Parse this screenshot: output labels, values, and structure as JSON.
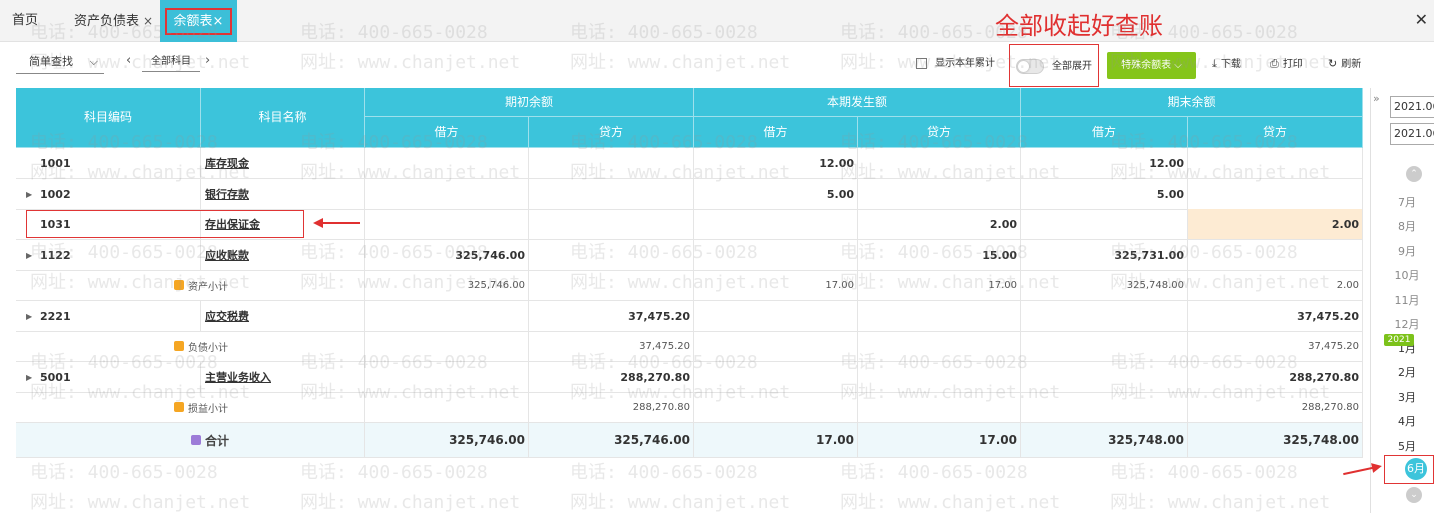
{
  "tabs": {
    "home": "首页",
    "balance_sheet": "资产负债表",
    "trial_balance": "余额表",
    "close": "×"
  },
  "annotation_title": "全部收起好查账",
  "toolbar": {
    "search_mode": "简单查找",
    "all_subjects": "全部科目",
    "show_year_cumulative": "显示本年累计",
    "expand_all": "全部展开",
    "special_balance": "特殊余额表",
    "download": "下载",
    "print": "打印",
    "refresh": "刷新"
  },
  "table": {
    "headers": {
      "code": "科目编码",
      "name": "科目名称",
      "opening": "期初余额",
      "current": "本期发生额",
      "closing": "期末余额",
      "debit": "借方",
      "credit": "贷方"
    },
    "rows": [
      {
        "code": "1001",
        "name": "库存现金",
        "od": "",
        "oc": "",
        "cd": "12.00",
        "cc": "",
        "ed": "12.00",
        "ec": ""
      },
      {
        "code": "1002",
        "name": "银行存款",
        "od": "",
        "oc": "",
        "cd": "5.00",
        "cc": "",
        "ed": "5.00",
        "ec": ""
      },
      {
        "code": "1031",
        "name": "存出保证金",
        "od": "",
        "oc": "",
        "cd": "",
        "cc": "2.00",
        "ed": "",
        "ec": "2.00"
      },
      {
        "code": "1122",
        "name": "应收账款",
        "od": "325,746.00",
        "oc": "",
        "cd": "",
        "cc": "15.00",
        "ed": "325,731.00",
        "ec": ""
      },
      {
        "sub": "资产小计",
        "od": "325,746.00",
        "oc": "",
        "cd": "17.00",
        "cc": "17.00",
        "ed": "325,748.00",
        "ec": "2.00"
      },
      {
        "code": "2221",
        "name": "应交税费",
        "od": "",
        "oc": "37,475.20",
        "cd": "",
        "cc": "",
        "ed": "",
        "ec": "37,475.20"
      },
      {
        "sub": "负债小计",
        "od": "",
        "oc": "37,475.20",
        "cd": "",
        "cc": "",
        "ed": "",
        "ec": "37,475.20"
      },
      {
        "code": "5001",
        "name": "主营业务收入",
        "od": "",
        "oc": "288,270.80",
        "cd": "",
        "cc": "",
        "ed": "",
        "ec": "288,270.80"
      },
      {
        "sub": "损益小计",
        "od": "",
        "oc": "288,270.80",
        "cd": "",
        "cc": "",
        "ed": "",
        "ec": "288,270.80"
      }
    ],
    "total": {
      "label": "合计",
      "od": "325,746.00",
      "oc": "325,746.00",
      "cd": "17.00",
      "cc": "17.00",
      "ed": "325,748.00",
      "ec": "325,748.00"
    }
  },
  "period": {
    "start": "2021.06",
    "end": "2021.06",
    "months_prev": [
      "7月",
      "8月",
      "9月",
      "10月",
      "11月",
      "12月"
    ],
    "year": "2021",
    "months": [
      "1月",
      "2月",
      "3月",
      "4月",
      "5月",
      "6月"
    ]
  },
  "watermark": {
    "phone": "电话: 400-665-0028",
    "site": "网址: www.chanjet.net"
  },
  "colors": {
    "header": "#3cc4db",
    "accent_green": "#85c51a",
    "annotation_red": "#e03535"
  }
}
